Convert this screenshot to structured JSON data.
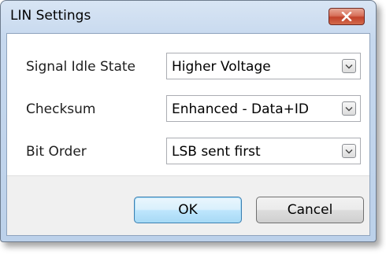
{
  "window": {
    "title": "LIN Settings",
    "close_icon": "close-icon"
  },
  "settings": [
    {
      "label": "Signal Idle State",
      "value": "Higher Voltage"
    },
    {
      "label": "Checksum",
      "value": "Enhanced - Data+ID"
    },
    {
      "label": "Bit Order",
      "value": "LSB sent first"
    }
  ],
  "buttons": {
    "ok_label": "OK",
    "cancel_label": "Cancel"
  },
  "colors": {
    "frame": "#c4d7ee",
    "close_button": "#c2422b",
    "default_button_border": "#3c7fb1"
  }
}
